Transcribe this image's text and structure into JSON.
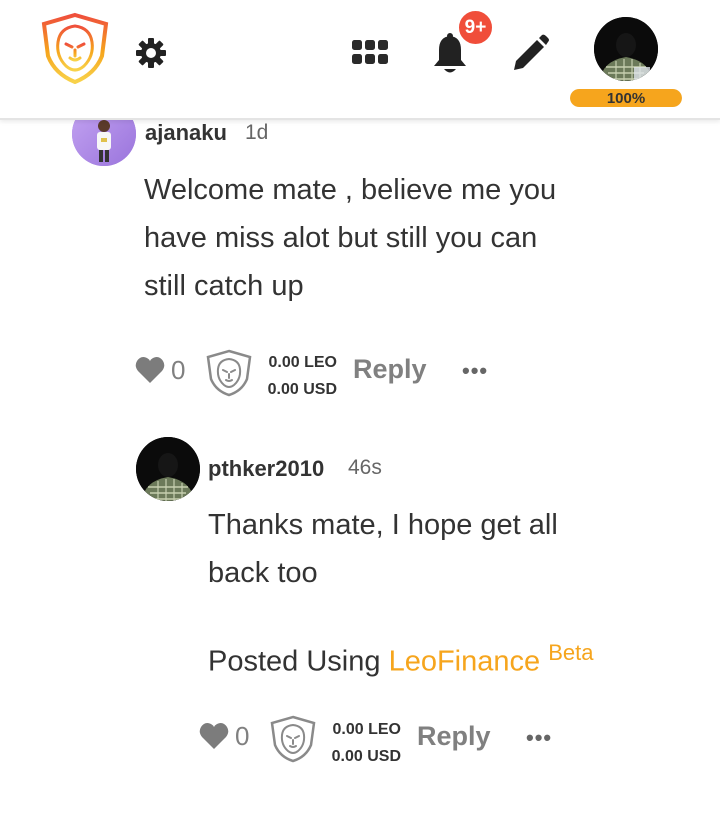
{
  "header": {
    "logo_icon": "leofinance-lion-logo",
    "settings_icon": "gear-icon",
    "apps_icon": "apps-grid-icon",
    "notifications_icon": "bell-icon",
    "notification_badge": "9+",
    "compose_icon": "pencil-icon",
    "user_avatar": "avatar",
    "profile_progress_label": "100%",
    "profile_progress_value": 1.0
  },
  "colors": {
    "accent": "#f6a51d",
    "badge": "#f04e3a",
    "muted": "#808080",
    "text": "#333333"
  },
  "comments": [
    {
      "username": "ajanaku",
      "time": "1d",
      "body_lines": [
        "Welcome mate , believe me you",
        "have miss alot but still you can",
        "still catch up"
      ],
      "likes": "0",
      "payout_leo": "0.00",
      "payout_leo_unit": "LEO",
      "payout_usd": "0.00",
      "payout_usd_unit": "USD",
      "reply_label": "Reply",
      "more_label": "•••"
    },
    {
      "username": "pthker2010",
      "time": "46s",
      "body_lines": [
        "Thanks mate, I hope get all",
        "back too"
      ],
      "posted_using_prefix": "Posted Using",
      "posted_using_link": "LeoFinance",
      "posted_using_suffix": "Beta",
      "likes": "0",
      "payout_leo": "0.00",
      "payout_leo_unit": "LEO",
      "payout_usd": "0.00",
      "payout_usd_unit": "USD",
      "reply_label": "Reply",
      "more_label": "•••"
    }
  ]
}
